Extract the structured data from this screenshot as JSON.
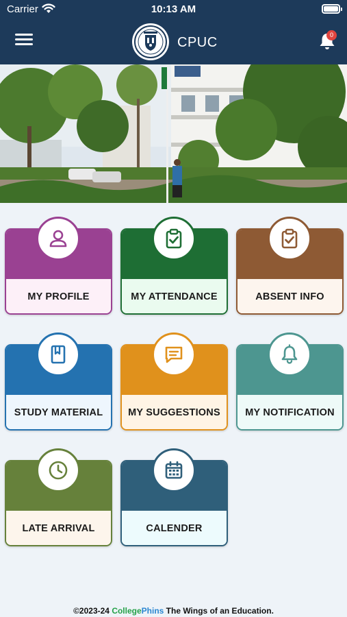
{
  "status_bar": {
    "carrier": "Carrier",
    "time": "10:13 AM"
  },
  "header": {
    "title": "CPUC",
    "notification_count": "0"
  },
  "tiles": [
    {
      "label": "MY PROFILE",
      "icon": "person-icon",
      "color": "#9a4192",
      "bg": "#fdf0f8"
    },
    {
      "label": "MY ATTENDANCE",
      "icon": "clipboard-check-icon",
      "color": "#1e6e34",
      "bg": "#eafbef"
    },
    {
      "label": "ABSENT INFO",
      "icon": "clipboard-check-icon",
      "color": "#8e5a34",
      "bg": "#fdf5ee"
    },
    {
      "label": "STUDY MATERIAL",
      "icon": "book-icon",
      "color": "#2472b0",
      "bg": "#eef6fd"
    },
    {
      "label": "MY SUGGESTIONS",
      "icon": "chat-icon",
      "color": "#e0911c",
      "bg": "#fff4e5"
    },
    {
      "label": "MY NOTIFICATION",
      "icon": "bell-icon",
      "color": "#4d9690",
      "bg": "#eefaf8"
    },
    {
      "label": "LATE ARRIVAL",
      "icon": "clock-icon",
      "color": "#66813b",
      "bg": "#fdf5ec"
    },
    {
      "label": "CALENDER",
      "icon": "calendar-icon",
      "color": "#2f5f7a",
      "bg": "#edfbfd"
    }
  ],
  "footer": {
    "copyright": "©2023-24",
    "brand_part1": "College",
    "brand_part2": "Phins",
    "tagline": "The Wings of an Education."
  }
}
